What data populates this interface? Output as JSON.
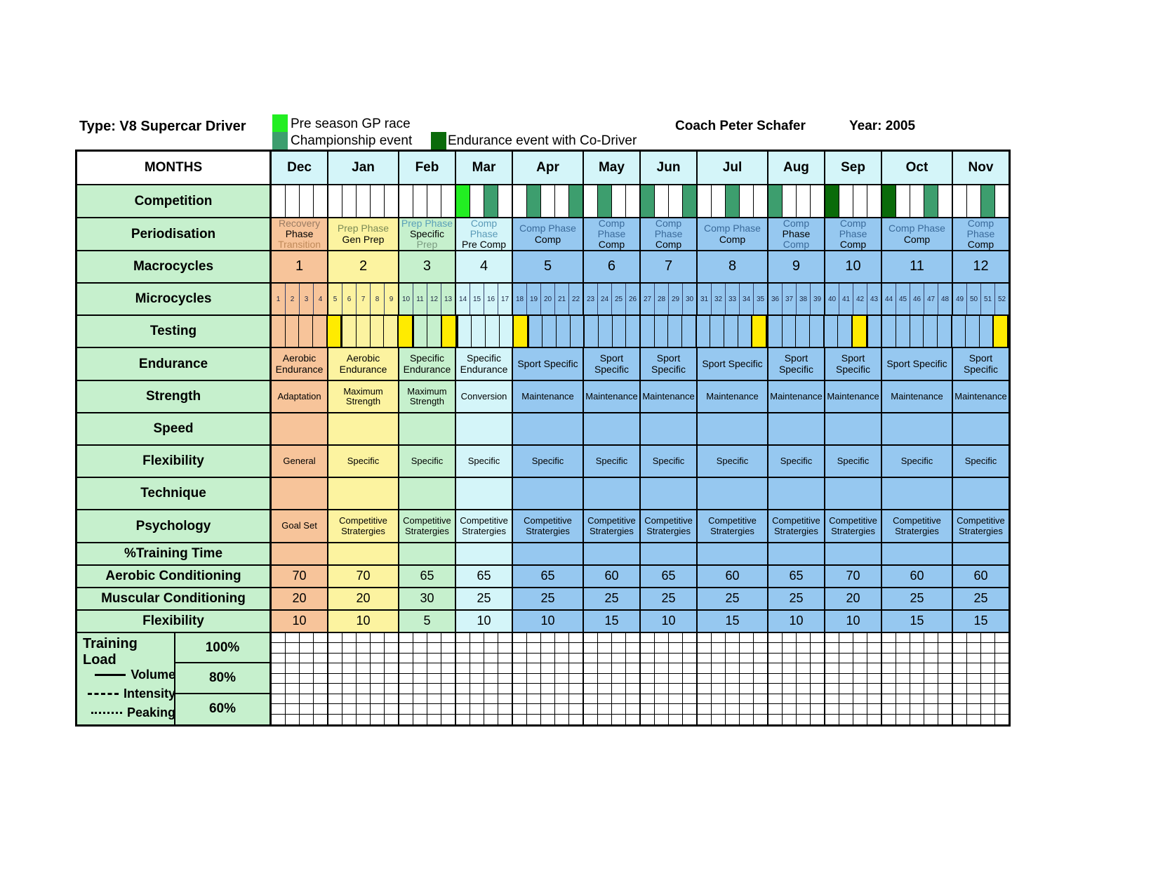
{
  "header": {
    "type_label": "Type: V8 Supercar Driver",
    "coach_label": "Coach Peter Schafer",
    "year_label": "Year: 2005",
    "legend": [
      {
        "name": "pre-season-gp-race",
        "label": "Pre season GP race",
        "color": "#22ee22"
      },
      {
        "name": "championship-event",
        "label": "Championship event",
        "color": "#3d9e6e"
      },
      {
        "name": "endurance-event",
        "label": "Endurance event with Co-Driver",
        "color": "#0a6b0a"
      }
    ]
  },
  "row_labels": {
    "months": "MONTHS",
    "competition": "Competition",
    "periodisation": "Periodisation",
    "macrocycles": "Macrocycles",
    "microcycles": "Microcycles",
    "testing": "Testing",
    "endurance": "Endurance",
    "strength": "Strength",
    "speed": "Speed",
    "flexibility": "Flexibility",
    "technique": "Technique",
    "psychology": "Psychology",
    "training_time": "%Training Time",
    "aerobic_conditioning": "Aerobic Conditioning",
    "muscular_conditioning": "Muscular Conditioning",
    "flexibility_pct": "Flexibility"
  },
  "training_load": {
    "title": "Training Load",
    "keys": [
      {
        "name": "volume",
        "label": "Volume",
        "style": "solid"
      },
      {
        "name": "intensity",
        "label": "Intensity",
        "style": "dashed"
      },
      {
        "name": "peaking",
        "label": "Peaking",
        "style": "dotted"
      }
    ],
    "percents": [
      "100%",
      "80%",
      "60%"
    ]
  },
  "chart_data": {
    "type": "table",
    "title": "V8 Supercar Driver Annual Training Periodisation Plan",
    "months": [
      "Dec",
      "Jan",
      "Feb",
      "Mar",
      "Apr",
      "May",
      "Jun",
      "Jul",
      "Aug",
      "Sep",
      "Oct",
      "Nov"
    ],
    "weeks_per_month": [
      4,
      5,
      4,
      4,
      5,
      4,
      4,
      5,
      4,
      4,
      5,
      4
    ],
    "total_weeks": 52,
    "microcycles": [
      1,
      2,
      3,
      4,
      5,
      6,
      7,
      8,
      9,
      10,
      11,
      12,
      13,
      14,
      15,
      16,
      17,
      18,
      19,
      20,
      21,
      22,
      23,
      24,
      25,
      26,
      27,
      28,
      29,
      30,
      31,
      32,
      33,
      34,
      35,
      36,
      37,
      38,
      39,
      40,
      41,
      42,
      43,
      44,
      45,
      46,
      47,
      48,
      49,
      50,
      51,
      52
    ],
    "competition_events": [
      {
        "week": 14,
        "type": "pre-season-gp-race",
        "color": "#22ee22"
      },
      {
        "week": 16,
        "type": "championship-event",
        "color": "#3d9e6e"
      },
      {
        "week": 19,
        "type": "championship-event",
        "color": "#3d9e6e"
      },
      {
        "week": 22,
        "type": "championship-event",
        "color": "#3d9e6e"
      },
      {
        "week": 24,
        "type": "championship-event",
        "color": "#3d9e6e"
      },
      {
        "week": 27,
        "type": "championship-event",
        "color": "#3d9e6e"
      },
      {
        "week": 30,
        "type": "championship-event",
        "color": "#3d9e6e"
      },
      {
        "week": 33,
        "type": "championship-event",
        "color": "#3d9e6e"
      },
      {
        "week": 36,
        "type": "championship-event",
        "color": "#3d9e6e"
      },
      {
        "week": 40,
        "type": "endurance-event",
        "color": "#0a6b0a"
      },
      {
        "week": 44,
        "type": "endurance-event",
        "color": "#0a6b0a"
      },
      {
        "week": 47,
        "type": "championship-event",
        "color": "#3d9e6e"
      },
      {
        "week": 51,
        "type": "championship-event",
        "color": "#3d9e6e"
      }
    ],
    "testing_weeks": [
      5,
      10,
      13,
      18,
      35,
      42,
      52
    ],
    "testing_color": "#ffeb00",
    "phase_colors": {
      "recovery": "#f7c49a",
      "prep_gen": "#fcf3a0",
      "prep_spec": "#c6f0cd",
      "pre_comp": "#d4f5f9",
      "comp": "#96c8f0"
    },
    "periodisation": [
      {
        "line1": "Recovery",
        "line2": "Phase",
        "line3": "Transition",
        "weeks": 4,
        "color": "#f7c49a",
        "color_l1": "#9a7b63",
        "color_l3": "#c08a5a"
      },
      {
        "line1": "Prep Phase",
        "line2": "Gen  Prep",
        "line3": "",
        "weeks": 5,
        "color": "#fcf3a0",
        "color_l1": "#7a8a55",
        "color_l3": ""
      },
      {
        "line1": "Prep Phase",
        "line2": "Specific",
        "line3": "Prep",
        "weeks": 4,
        "color": "#c6f0cd",
        "color_l1": "#5aa0b8",
        "color_l3": "#7a9a80"
      },
      {
        "line1": "Comp Phase",
        "line2": "Pre Comp",
        "line3": "",
        "weeks": 4,
        "color": "#d4f5f9",
        "color_l1": "#5a9ab8",
        "color_l3": ""
      },
      {
        "line1": "Comp Phase",
        "line2": "Comp",
        "line3": "",
        "weeks": 5,
        "color": "#96c8f0",
        "color_l1": "#3a6a9a",
        "color_l3": ""
      },
      {
        "line1": "Comp Phase",
        "line2": "Comp",
        "line3": "",
        "weeks": 4,
        "color": "#96c8f0",
        "color_l1": "#3a6a9a",
        "color_l3": ""
      },
      {
        "line1": "Comp Phase",
        "line2": "Comp",
        "line3": "",
        "weeks": 4,
        "color": "#96c8f0",
        "color_l1": "#3a6a9a",
        "color_l3": ""
      },
      {
        "line1": "Comp Phase",
        "line2": "Comp",
        "line3": "",
        "weeks": 5,
        "color": "#96c8f0",
        "color_l1": "#3a6a9a",
        "color_l3": ""
      },
      {
        "line1": "Comp",
        "line2": "Phase",
        "line3": "Comp",
        "weeks": 4,
        "color": "#96c8f0",
        "color_l1": "#3a6a9a",
        "color_l3": "#3a6a9a"
      },
      {
        "line1": "Comp Phase",
        "line2": "Comp",
        "line3": "",
        "weeks": 4,
        "color": "#96c8f0",
        "color_l1": "#3a6a9a",
        "color_l3": ""
      },
      {
        "line1": "Comp Phase",
        "line2": "Comp",
        "line3": "",
        "weeks": 5,
        "color": "#96c8f0",
        "color_l1": "#3a6a9a",
        "color_l3": ""
      },
      {
        "line1": "Comp Phase",
        "line2": "Comp",
        "line3": "",
        "weeks": 4,
        "color": "#96c8f0",
        "color_l1": "#3a6a9a",
        "color_l3": ""
      }
    ],
    "macrocycles": [
      {
        "value": "1",
        "weeks": 4,
        "color": "#f7c49a"
      },
      {
        "value": "2",
        "weeks": 9,
        "color": "#fcf3a0"
      },
      {
        "value": "3",
        "weeks": 0,
        "color": "#c6f0cd"
      },
      {
        "value": "4",
        "weeks": 4,
        "color": "#d4f5f9"
      },
      {
        "value": "5",
        "weeks": 5,
        "color": "#96c8f0"
      },
      {
        "value": "6",
        "weeks": 4,
        "color": "#96c8f0"
      },
      {
        "value": "7",
        "weeks": 4,
        "color": "#96c8f0"
      },
      {
        "value": "8",
        "weeks": 5,
        "color": "#96c8f0"
      },
      {
        "value": "9",
        "weeks": 4,
        "color": "#96c8f0"
      },
      {
        "value": "10",
        "weeks": 4,
        "color": "#96c8f0"
      },
      {
        "value": "11",
        "weeks": 5,
        "color": "#96c8f0"
      },
      {
        "value": "12",
        "weeks": 4,
        "color": "#96c8f0"
      }
    ],
    "macrocycle_cells": [
      {
        "value": "1",
        "weeks": 4,
        "color": "#f7c49a"
      },
      {
        "value": "2",
        "weeks": 5,
        "color": "#fcf3a0"
      },
      {
        "value": "3",
        "weeks": 4,
        "color": "#c6f0cd"
      },
      {
        "value": "4",
        "weeks": 4,
        "color": "#d4f5f9"
      },
      {
        "value": "5",
        "weeks": 5,
        "color": "#96c8f0"
      },
      {
        "value": "6",
        "weeks": 4,
        "color": "#96c8f0"
      },
      {
        "value": "7",
        "weeks": 4,
        "color": "#96c8f0"
      },
      {
        "value": "8",
        "weeks": 5,
        "color": "#96c8f0"
      },
      {
        "value": "9",
        "weeks": 4,
        "color": "#96c8f0"
      },
      {
        "value": "10",
        "weeks": 4,
        "color": "#96c8f0"
      },
      {
        "value": "11",
        "weeks": 5,
        "color": "#96c8f0"
      },
      {
        "value": "12",
        "weeks": 4,
        "color": "#96c8f0"
      }
    ],
    "endurance": [
      {
        "line1": "Aerobic",
        "line2": "Endurance",
        "weeks": 4,
        "color": "#f7c49a"
      },
      {
        "line1": "Aerobic",
        "line2": "Endurance",
        "weeks": 5,
        "color": "#fcf3a0"
      },
      {
        "line1": "Specific",
        "line2": "Endurance",
        "weeks": 4,
        "color": "#c6f0cd"
      },
      {
        "line1": "Specific",
        "line2": "Endurance",
        "weeks": 4,
        "color": "#d4f5f9"
      },
      {
        "line1": "Sport Specific",
        "line2": "",
        "weeks": 5,
        "color": "#96c8f0"
      },
      {
        "line1": "Sport",
        "line2": "Specific",
        "weeks": 4,
        "color": "#96c8f0"
      },
      {
        "line1": "Sport",
        "line2": "Specific",
        "weeks": 4,
        "color": "#96c8f0"
      },
      {
        "line1": "Sport Specific",
        "line2": "",
        "weeks": 5,
        "color": "#96c8f0"
      },
      {
        "line1": "Sport",
        "line2": "Specific",
        "weeks": 4,
        "color": "#96c8f0"
      },
      {
        "line1": "Sport",
        "line2": "Specific",
        "weeks": 4,
        "color": "#96c8f0"
      },
      {
        "line1": "Sport Specific",
        "line2": "",
        "weeks": 5,
        "color": "#96c8f0"
      },
      {
        "line1": "Sport",
        "line2": "Specific",
        "weeks": 4,
        "color": "#96c8f0"
      }
    ],
    "strength": [
      {
        "line1": "Adaptation",
        "line2": "",
        "weeks": 4,
        "color": "#f7c49a"
      },
      {
        "line1": "Maximum",
        "line2": "Strength",
        "weeks": 5,
        "color": "#fcf3a0"
      },
      {
        "line1": "Maximum",
        "line2": "Strength",
        "weeks": 4,
        "color": "#c6f0cd"
      },
      {
        "line1": "Conversion",
        "line2": "",
        "weeks": 4,
        "color": "#d4f5f9"
      },
      {
        "line1": "Maintenance",
        "line2": "",
        "weeks": 5,
        "color": "#96c8f0"
      },
      {
        "line1": "Maintenance",
        "line2": "",
        "weeks": 4,
        "color": "#96c8f0"
      },
      {
        "line1": "Maintenance",
        "line2": "",
        "weeks": 4,
        "color": "#96c8f0"
      },
      {
        "line1": "Maintenance",
        "line2": "",
        "weeks": 5,
        "color": "#96c8f0"
      },
      {
        "line1": "Maintenance",
        "line2": "",
        "weeks": 4,
        "color": "#96c8f0"
      },
      {
        "line1": "Maintenance",
        "line2": "",
        "weeks": 4,
        "color": "#96c8f0"
      },
      {
        "line1": "Maintenance",
        "line2": "",
        "weeks": 5,
        "color": "#96c8f0"
      },
      {
        "line1": "Maintenance",
        "line2": "",
        "weeks": 4,
        "color": "#96c8f0"
      }
    ],
    "speed": [
      {
        "line1": "",
        "weeks": 4,
        "color": "#f7c49a"
      },
      {
        "line1": "",
        "weeks": 5,
        "color": "#fcf3a0"
      },
      {
        "line1": "",
        "weeks": 4,
        "color": "#c6f0cd"
      },
      {
        "line1": "",
        "weeks": 4,
        "color": "#d4f5f9"
      },
      {
        "line1": "",
        "weeks": 5,
        "color": "#96c8f0"
      },
      {
        "line1": "",
        "weeks": 4,
        "color": "#96c8f0"
      },
      {
        "line1": "",
        "weeks": 4,
        "color": "#96c8f0"
      },
      {
        "line1": "",
        "weeks": 5,
        "color": "#96c8f0"
      },
      {
        "line1": "",
        "weeks": 4,
        "color": "#96c8f0"
      },
      {
        "line1": "",
        "weeks": 4,
        "color": "#96c8f0"
      },
      {
        "line1": "",
        "weeks": 5,
        "color": "#96c8f0"
      },
      {
        "line1": "",
        "weeks": 4,
        "color": "#96c8f0"
      }
    ],
    "flexibility": [
      {
        "line1": "General",
        "weeks": 4,
        "color": "#f7c49a"
      },
      {
        "line1": "Specific",
        "weeks": 5,
        "color": "#fcf3a0"
      },
      {
        "line1": "Specific",
        "weeks": 4,
        "color": "#c6f0cd"
      },
      {
        "line1": "Specific",
        "weeks": 4,
        "color": "#d4f5f9"
      },
      {
        "line1": "Specific",
        "weeks": 5,
        "color": "#96c8f0"
      },
      {
        "line1": "Specific",
        "weeks": 4,
        "color": "#96c8f0"
      },
      {
        "line1": "Specific",
        "weeks": 4,
        "color": "#96c8f0"
      },
      {
        "line1": "Specific",
        "weeks": 5,
        "color": "#96c8f0"
      },
      {
        "line1": "Specific",
        "weeks": 4,
        "color": "#96c8f0"
      },
      {
        "line1": "Specific",
        "weeks": 4,
        "color": "#96c8f0"
      },
      {
        "line1": "Specific",
        "weeks": 5,
        "color": "#96c8f0"
      },
      {
        "line1": "Specific",
        "weeks": 4,
        "color": "#96c8f0"
      }
    ],
    "technique": [
      {
        "line1": "",
        "weeks": 4,
        "color": "#f7c49a"
      },
      {
        "line1": "",
        "weeks": 5,
        "color": "#fcf3a0"
      },
      {
        "line1": "",
        "weeks": 4,
        "color": "#c6f0cd"
      },
      {
        "line1": "",
        "weeks": 4,
        "color": "#d4f5f9"
      },
      {
        "line1": "",
        "weeks": 5,
        "color": "#96c8f0"
      },
      {
        "line1": "",
        "weeks": 4,
        "color": "#96c8f0"
      },
      {
        "line1": "",
        "weeks": 4,
        "color": "#96c8f0"
      },
      {
        "line1": "",
        "weeks": 5,
        "color": "#96c8f0"
      },
      {
        "line1": "",
        "weeks": 4,
        "color": "#96c8f0"
      },
      {
        "line1": "",
        "weeks": 4,
        "color": "#96c8f0"
      },
      {
        "line1": "",
        "weeks": 5,
        "color": "#96c8f0"
      },
      {
        "line1": "",
        "weeks": 4,
        "color": "#96c8f0"
      }
    ],
    "psychology": [
      {
        "line1": "Goal Set",
        "line2": "",
        "weeks": 4,
        "color": "#f7c49a"
      },
      {
        "line1": "Competitive",
        "line2": "Stratergies",
        "weeks": 5,
        "color": "#fcf3a0"
      },
      {
        "line1": "Competitive",
        "line2": "Stratergies",
        "weeks": 4,
        "color": "#c6f0cd"
      },
      {
        "line1": "Competitive",
        "line2": "Stratergies",
        "weeks": 4,
        "color": "#d4f5f9"
      },
      {
        "line1": "Competitive",
        "line2": "Stratergies",
        "weeks": 5,
        "color": "#96c8f0"
      },
      {
        "line1": "Competitive",
        "line2": "Stratergies",
        "weeks": 4,
        "color": "#96c8f0"
      },
      {
        "line1": "Competitive",
        "line2": "Stratergies",
        "weeks": 4,
        "color": "#96c8f0"
      },
      {
        "line1": "Competitive",
        "line2": "Stratergies",
        "weeks": 5,
        "color": "#96c8f0"
      },
      {
        "line1": "Competitive",
        "line2": "Stratergies",
        "weeks": 4,
        "color": "#96c8f0"
      },
      {
        "line1": "Competitive",
        "line2": "Stratergies",
        "weeks": 4,
        "color": "#96c8f0"
      },
      {
        "line1": "Competitive",
        "line2": "Stratergies",
        "weeks": 5,
        "color": "#96c8f0"
      },
      {
        "line1": "Competitive",
        "line2": "Stratergies",
        "weeks": 4,
        "color": "#96c8f0"
      }
    ],
    "training_time_blank": [
      {
        "line1": "",
        "weeks": 4,
        "color": "#f7c49a"
      },
      {
        "line1": "",
        "weeks": 5,
        "color": "#fcf3a0"
      },
      {
        "line1": "",
        "weeks": 4,
        "color": "#c6f0cd"
      },
      {
        "line1": "",
        "weeks": 4,
        "color": "#d4f5f9"
      },
      {
        "line1": "",
        "weeks": 5,
        "color": "#96c8f0"
      },
      {
        "line1": "",
        "weeks": 4,
        "color": "#96c8f0"
      },
      {
        "line1": "",
        "weeks": 4,
        "color": "#96c8f0"
      },
      {
        "line1": "",
        "weeks": 5,
        "color": "#96c8f0"
      },
      {
        "line1": "",
        "weeks": 4,
        "color": "#96c8f0"
      },
      {
        "line1": "",
        "weeks": 4,
        "color": "#96c8f0"
      },
      {
        "line1": "",
        "weeks": 5,
        "color": "#96c8f0"
      },
      {
        "line1": "",
        "weeks": 4,
        "color": "#96c8f0"
      }
    ],
    "aerobic_conditioning": {
      "values": [
        70,
        70,
        65,
        65,
        65,
        60,
        65,
        60,
        65,
        70,
        60,
        60
      ],
      "colors": [
        "#f7c49a",
        "#fcf3a0",
        "#c6f0cd",
        "#d4f5f9",
        "#96c8f0",
        "#96c8f0",
        "#96c8f0",
        "#96c8f0",
        "#96c8f0",
        "#96c8f0",
        "#96c8f0",
        "#96c8f0"
      ],
      "weeks": [
        4,
        5,
        4,
        4,
        5,
        4,
        4,
        5,
        4,
        4,
        5,
        4
      ]
    },
    "muscular_conditioning": {
      "values": [
        20,
        20,
        30,
        25,
        25,
        25,
        25,
        25,
        25,
        20,
        25,
        25
      ],
      "colors": [
        "#f7c49a",
        "#fcf3a0",
        "#c6f0cd",
        "#d4f5f9",
        "#96c8f0",
        "#96c8f0",
        "#96c8f0",
        "#96c8f0",
        "#96c8f0",
        "#96c8f0",
        "#96c8f0",
        "#96c8f0"
      ],
      "weeks": [
        4,
        5,
        4,
        4,
        5,
        4,
        4,
        5,
        4,
        4,
        5,
        4
      ]
    },
    "flexibility_pct": {
      "values": [
        10,
        10,
        5,
        10,
        10,
        15,
        10,
        15,
        10,
        10,
        15,
        15
      ],
      "colors": [
        "#f7c49a",
        "#fcf3a0",
        "#c6f0cd",
        "#d4f5f9",
        "#96c8f0",
        "#96c8f0",
        "#96c8f0",
        "#96c8f0",
        "#96c8f0",
        "#96c8f0",
        "#96c8f0",
        "#96c8f0"
      ],
      "weeks": [
        4,
        5,
        4,
        4,
        5,
        4,
        4,
        5,
        4,
        4,
        5,
        4
      ]
    },
    "training_load_grid": {
      "rows": 9,
      "cols": 52
    }
  }
}
